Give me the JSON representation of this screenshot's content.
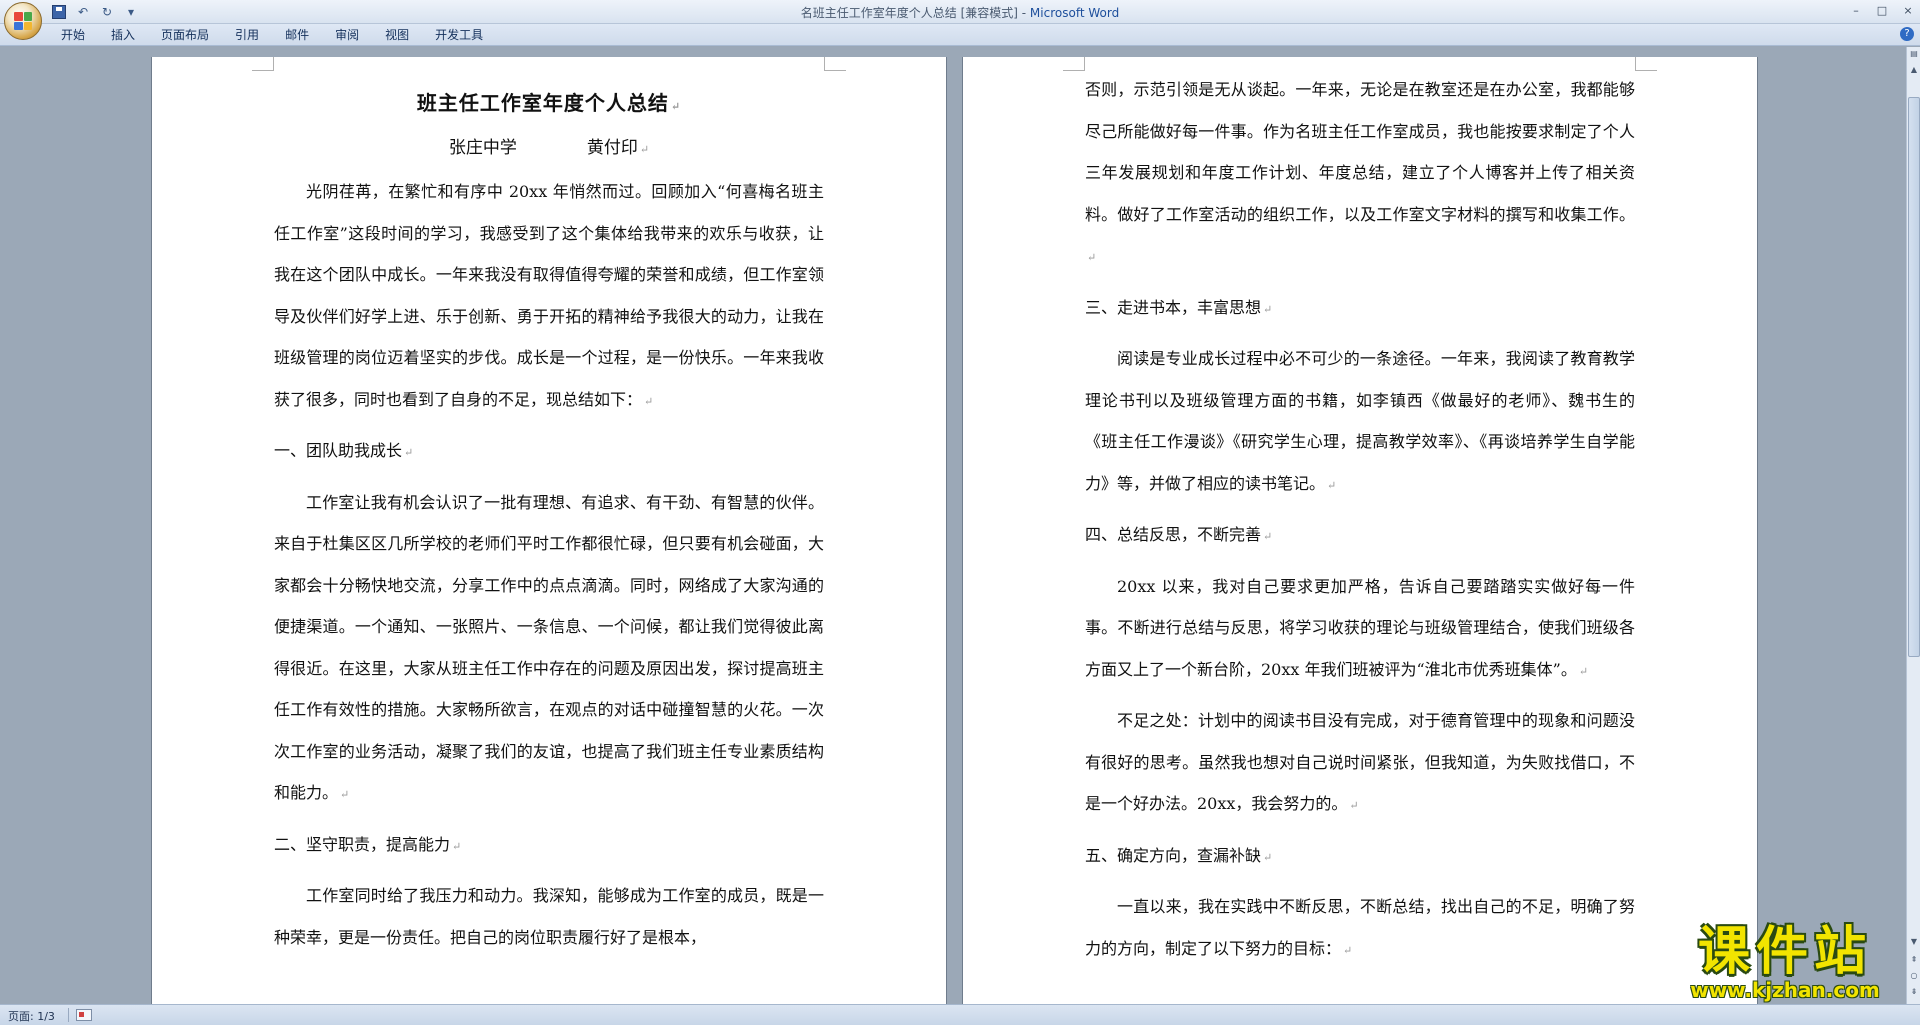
{
  "window": {
    "title_doc": "名班主任工作室年度个人总结 [兼容模式] - ",
    "title_app": "Microsoft Word",
    "controls": {
      "minimize": "–",
      "maximize": "□",
      "close": "×"
    }
  },
  "quick_access": {
    "undo": "↶",
    "redo": "↻",
    "customize": "▾"
  },
  "ribbon": {
    "tabs": [
      "开始",
      "插入",
      "页面布局",
      "引用",
      "邮件",
      "审阅",
      "视图",
      "开发工具"
    ],
    "help": "?"
  },
  "page1": {
    "title": "班主任工作室年度个人总结",
    "school": "张庄中学",
    "author": "黄付印",
    "intro": "光阴荏苒，在繁忙和有序中 20xx 年悄然而过。回顾加入“何喜梅名班主任工作室”这段时间的学习，我感受到了这个集体给我带来的欢乐与收获，让我在这个团队中成长。一年来我没有取得值得夸耀的荣誉和成绩，但工作室领导及伙伴们好学上进、乐于创新、勇于开拓的精神给予我很大的动力，让我在班级管理的岗位迈着坚实的步伐。成长是一个过程，是一份快乐。一年来我收获了很多，同时也看到了自身的不足，现总结如下：",
    "h1": "一、团队助我成长",
    "p1": "工作室让我有机会认识了一批有理想、有追求、有干劲、有智慧的伙伴。来自于杜集区区几所学校的老师们平时工作都很忙碌，但只要有机会碰面，大家都会十分畅快地交流，分享工作中的点点滴滴。同时，网络成了大家沟通的便捷渠道。一个通知、一张照片、一条信息、一个问候，都让我们觉得彼此离得很近。在这里，大家从班主任工作中存在的问题及原因出发，探讨提高班主任工作有效性的措施。大家畅所欲言，在观点的对话中碰撞智慧的火花。一次次工作室的业务活动，凝聚了我们的友谊，也提高了我们班主任专业素质结构和能力。",
    "h2": "二、坚守职责，提高能力",
    "p2": "工作室同时给了我压力和动力。我深知，能够成为工作室的成员，既是一种荣幸，更是一份责任。把自己的岗位职责履行好了是根本，"
  },
  "page2": {
    "p_cont": "否则，示范引领是无从谈起。一年来，无论是在教室还是在办公室，我都能够尽己所能做好每一件事。作为名班主任工作室成员，我也能按要求制定了个人三年发展规划和年度工作计划、年度总结，建立了个人博客并上传了相关资料。做好了工作室活动的组织工作，以及工作室文字材料的撰写和收集工作。",
    "h3": "三、走进书本，丰富思想",
    "p3": "阅读是专业成长过程中必不可少的一条途径。一年来，我阅读了教育教学理论书刊以及班级管理方面的书籍，如李镇西《做最好的老师》、魏书生的《班主任工作漫谈》《研究学生心理，提高教学效率》、《再谈培养学生自学能力》等，并做了相应的读书笔记。",
    "h4": "四、总结反思，不断完善",
    "p4": "20xx 以来，我对自己要求更加严格，告诉自己要踏踏实实做好每一件事。不断进行总结与反思，将学习收获的理论与班级管理结合，使我们班级各方面又上了一个新台阶，20xx 年我们班被评为“淮北市优秀班集体”。",
    "p5": "不足之处：计划中的阅读书目没有完成，对于德育管理中的现象和问题没有很好的思考。虽然我也想对自己说时间紧张，但我知道，为失败找借口，不是一个好办法。20xx，我会努力的。",
    "h5": "五、确定方向，查漏补缺",
    "p6": "一直以来，我在实践中不断反思，不断总结，找出自己的不足，明确了努力的方向，制定了以下努力的目标："
  },
  "paragraph_mark": "↵",
  "status": {
    "page": "页面: 1/3"
  },
  "watermark": {
    "main": "课件站",
    "url": "www.kjzhan.com"
  },
  "colors": {
    "accent": "#1e4f9c",
    "workspace": "#9ba8b7",
    "watermark": "#f2e400"
  }
}
